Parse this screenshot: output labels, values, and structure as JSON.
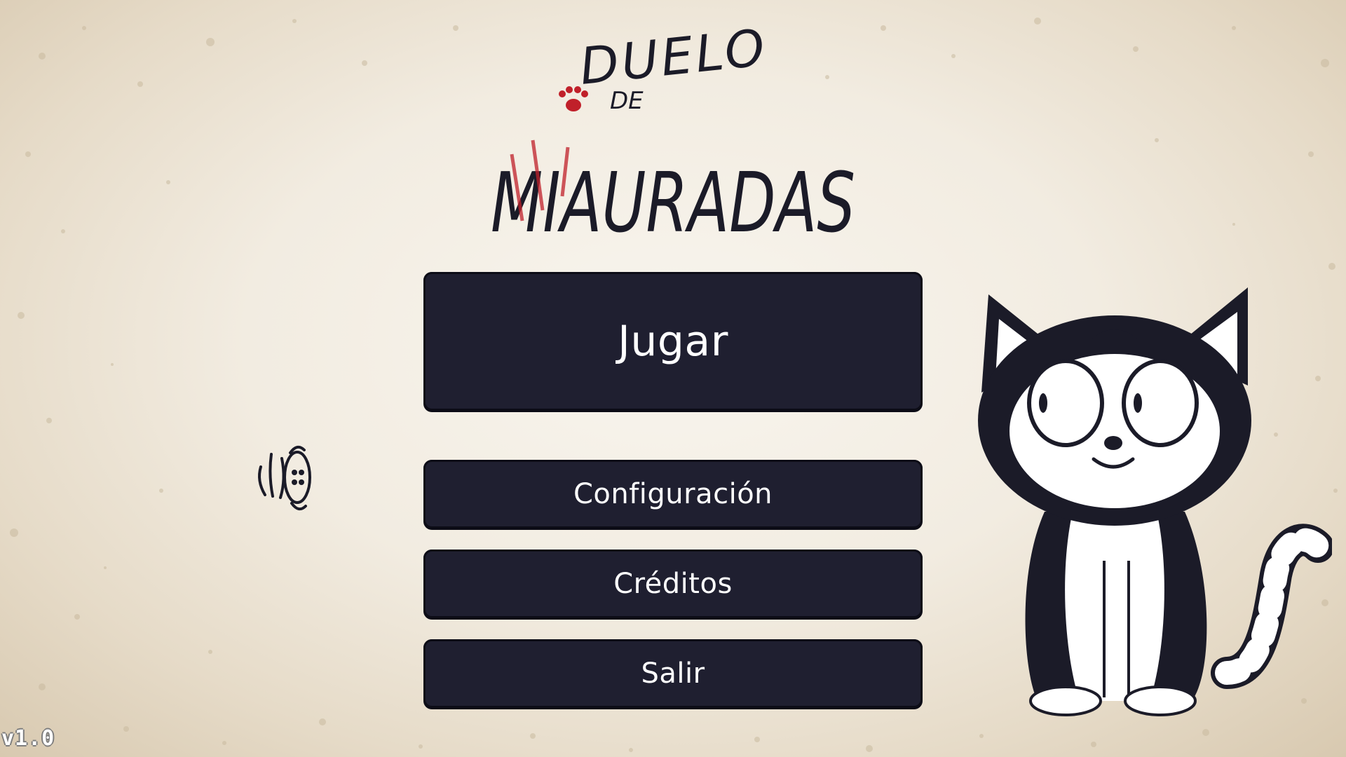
{
  "title": {
    "line1": "DUELO",
    "line2": "DE",
    "line3": "MIAURADAS"
  },
  "menu": {
    "play_label": "Jugar",
    "config_label": "Configuración",
    "credits_label": "Créditos",
    "exit_label": "Salir"
  },
  "version": "v1.0",
  "colors": {
    "button_bg": "#1f1f30",
    "button_text": "#ffffff",
    "title_dark": "#1b1b28",
    "title_red": "#c0202a",
    "paper": "#f2ece1"
  },
  "icons": {
    "paw": "paw-icon",
    "mouse": "mouse-icon",
    "cat": "cat-character"
  }
}
